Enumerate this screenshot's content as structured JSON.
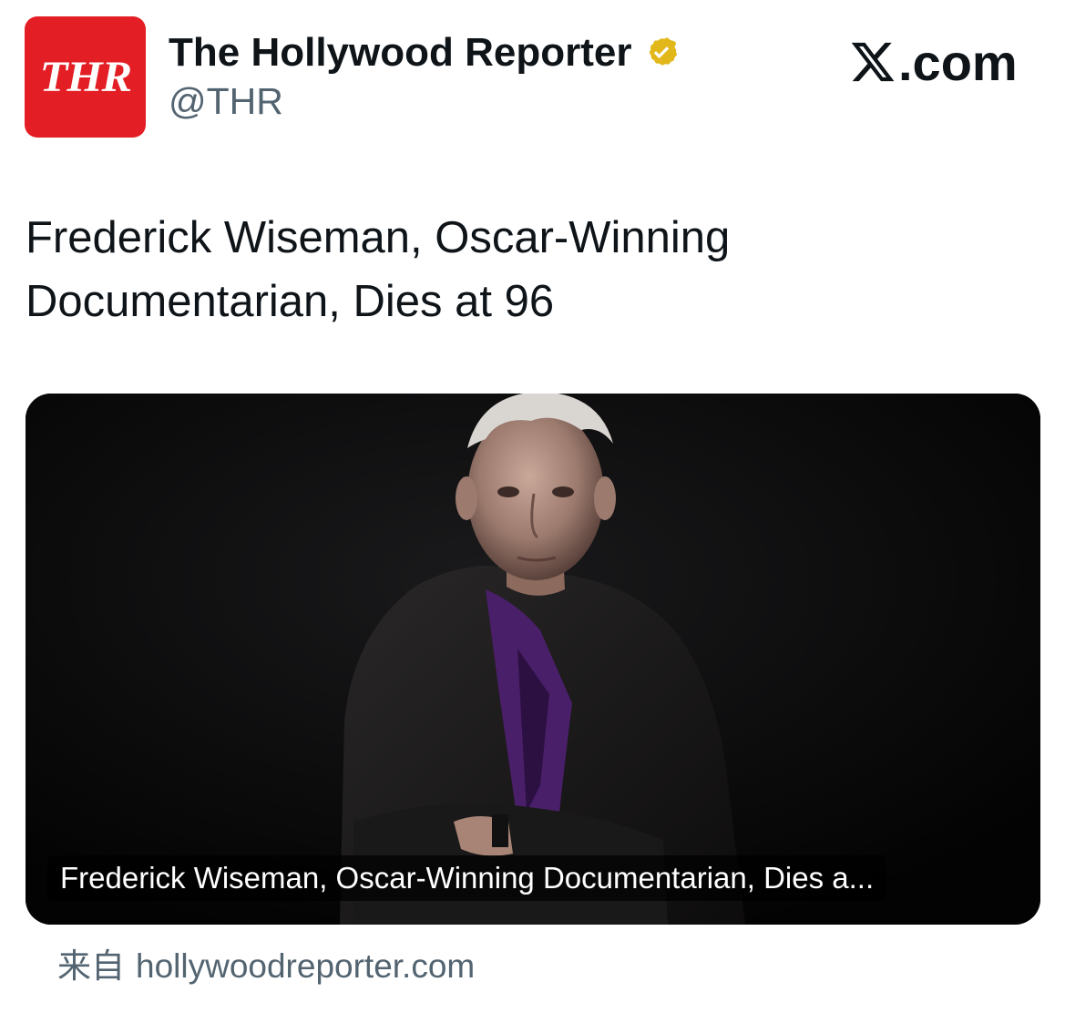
{
  "account": {
    "avatar_text": "THR",
    "display_name": "The Hollywood Reporter",
    "handle": "@THR",
    "verified_badge": "gold-verified-checkmark-icon",
    "avatar_color": "#e31e24",
    "badge_color": "#e2b719"
  },
  "brand": {
    "suffix": ".com",
    "icon": "x-logo-icon"
  },
  "tweet": {
    "text": "Frederick Wiseman, Oscar-Winning Documentarian, Dies at 96"
  },
  "media": {
    "caption": "Frederick Wiseman, Oscar-Winning Documentarian, Dies a...",
    "source_prefix": "来自",
    "source_domain": "hollywoodreporter.com"
  },
  "colors": {
    "text_primary": "#0f1419",
    "text_secondary": "#536471",
    "media_background": "#050505"
  }
}
